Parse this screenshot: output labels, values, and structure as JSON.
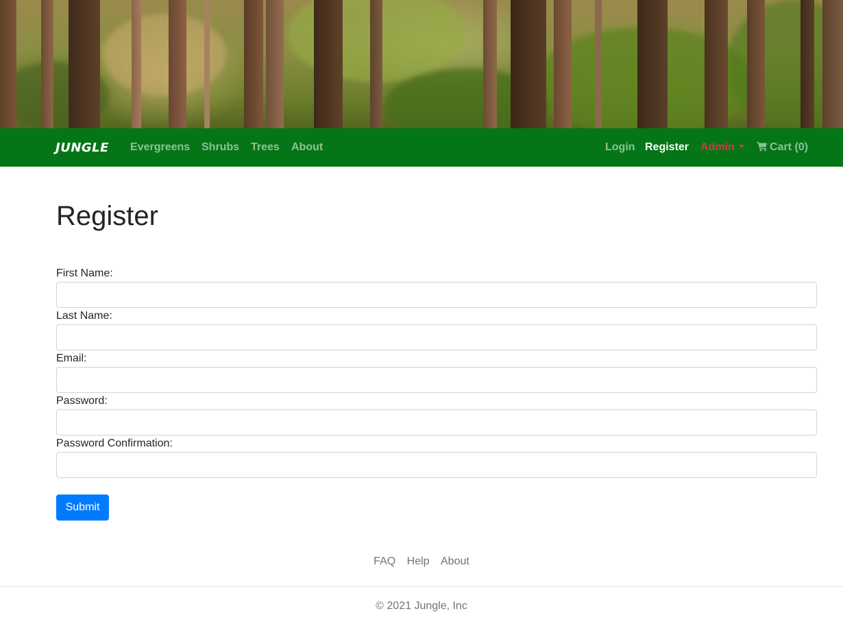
{
  "header": {
    "brand": "JUNGLE",
    "nav_left": [
      {
        "label": "Evergreens"
      },
      {
        "label": "Shrubs"
      },
      {
        "label": "Trees"
      },
      {
        "label": "About"
      }
    ],
    "nav_right": {
      "login": "Login",
      "register": "Register",
      "admin": "Admin",
      "cart": "Cart (0)"
    },
    "colors": {
      "navbar": "#047617",
      "admin": "#dc3545"
    }
  },
  "main": {
    "title": "Register",
    "fields": [
      {
        "label": "First Name:",
        "value": ""
      },
      {
        "label": "Last Name:",
        "value": ""
      },
      {
        "label": "Email:",
        "value": ""
      },
      {
        "label": "Password:",
        "value": ""
      },
      {
        "label": "Password Confirmation:",
        "value": ""
      }
    ],
    "submit_label": "Submit",
    "submit_color": "#007bff"
  },
  "footer": {
    "links": [
      {
        "label": "FAQ"
      },
      {
        "label": "Help"
      },
      {
        "label": "About"
      }
    ],
    "copyright": "© 2021 Jungle, Inc"
  }
}
